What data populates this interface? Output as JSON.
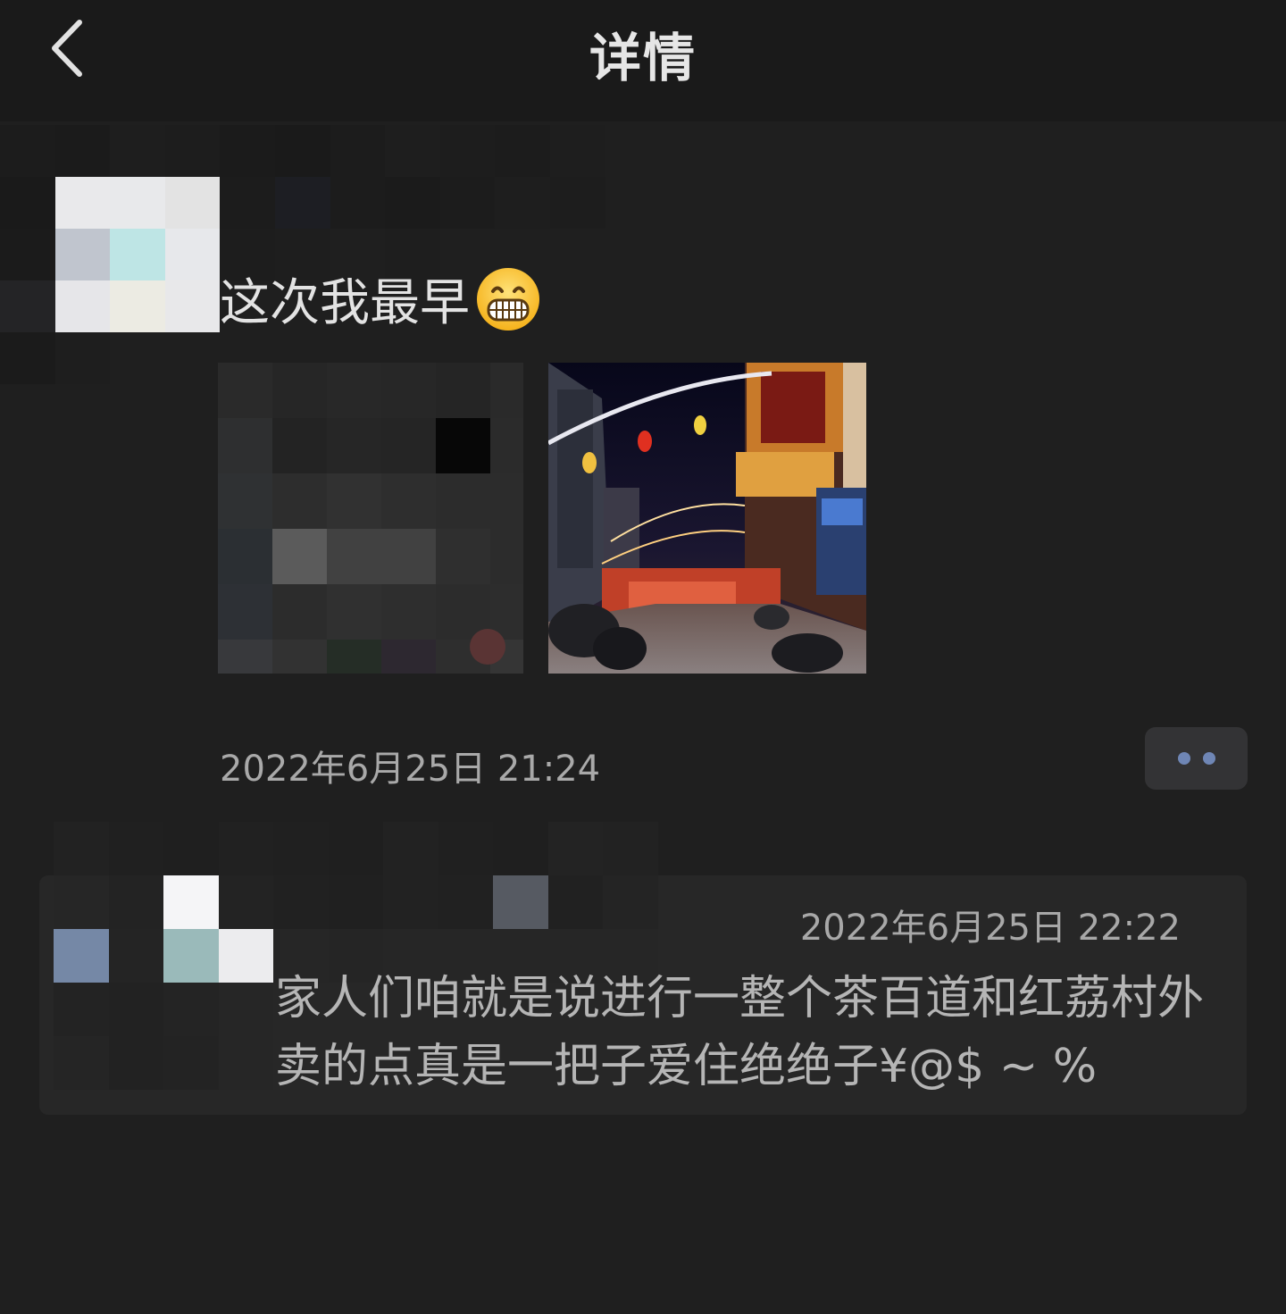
{
  "header": {
    "title": "详情"
  },
  "post": {
    "text": "这次我最早",
    "emoji": "grinning-face",
    "time": "2022年6月25日 21:24"
  },
  "comment": {
    "time": "2022年6月25日 22:22",
    "text": "家人们咱就是说进行一整个茶百道和红荔村外卖的点真是一把子爱住绝绝子¥@$ ~ %"
  },
  "colors": {
    "background": "#1f1f1f",
    "header": "#1a1a1a",
    "panel": "#272727",
    "accent_dot": "#6f86b5"
  }
}
